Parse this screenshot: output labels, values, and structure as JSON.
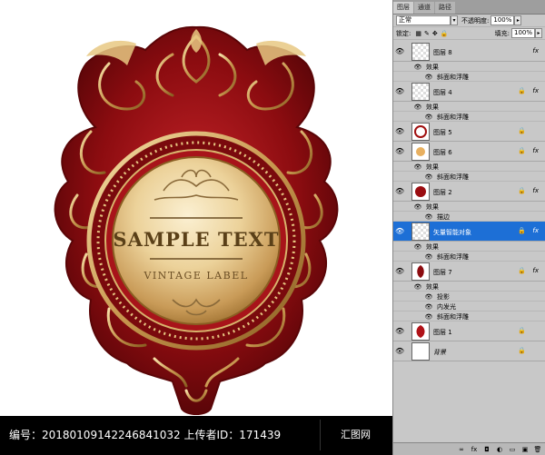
{
  "label": {
    "main_text": "SAMPLE TEXT",
    "sub_text": "VINTAGE LABEL"
  },
  "footer": {
    "text": "编号：20180109142246841032 上传者ID：171439",
    "logo": "汇图网"
  },
  "panel": {
    "tabs": [
      "图层",
      "通道",
      "路径"
    ],
    "blend_mode": "正常",
    "opacity_label": "不透明度:",
    "opacity_value": "100%",
    "lock_label": "锁定:",
    "fill_label": "填充:",
    "fill_value": "100%",
    "layers": [
      {
        "name": "图层 8",
        "fx": "fx",
        "lock": "",
        "thumb": "checker",
        "effects_label": "效果",
        "effects": [
          "斜面和浮雕"
        ]
      },
      {
        "name": "图层 4",
        "fx": "fx",
        "lock": "🔒",
        "thumb": "checker",
        "effects_label": "效果",
        "effects": [
          "斜面和浮雕"
        ]
      },
      {
        "name": "图层 5",
        "fx": "",
        "lock": "🔒",
        "thumb": "ring",
        "effects_label": "",
        "effects": []
      },
      {
        "name": "图层 6",
        "fx": "fx",
        "lock": "🔒",
        "thumb": "sparkle",
        "effects_label": "效果",
        "effects": [
          "斜面和浮雕"
        ]
      },
      {
        "name": "图层 2",
        "fx": "fx",
        "lock": "🔒",
        "thumb": "reddisk",
        "effects_label": "效果",
        "effects": [
          "描边"
        ]
      },
      {
        "name": "矢量智能对象",
        "fx": "fx",
        "lock": "🔒",
        "thumb": "checker",
        "effects_label": "效果",
        "effects": [
          "斜面和浮雕"
        ],
        "selected": true
      },
      {
        "name": "图层 7",
        "fx": "fx",
        "lock": "🔒",
        "thumb": "ornament",
        "effects_label": "效果",
        "effects": [
          "投影",
          "内发光",
          "斜面和浮雕"
        ]
      },
      {
        "name": "图层 1",
        "fx": "",
        "lock": "🔒",
        "thumb": "red",
        "effects_label": "",
        "effects": []
      },
      {
        "name": "背景",
        "fx": "",
        "lock": "🔒",
        "thumb": "white",
        "effects_label": "",
        "effects": []
      }
    ],
    "bottom_icons": [
      "link-icon",
      "fx-icon",
      "mask-icon",
      "adjustment-icon",
      "folder-icon",
      "new-layer-icon",
      "trash-icon"
    ]
  },
  "colors": {
    "crimson": "#8c0c10",
    "deep_red": "#5e0608",
    "gold_light": "#f6e2b0",
    "gold_mid": "#d8b36c",
    "gold_dark": "#a67a38",
    "selection_blue": "#1d6fd6"
  }
}
